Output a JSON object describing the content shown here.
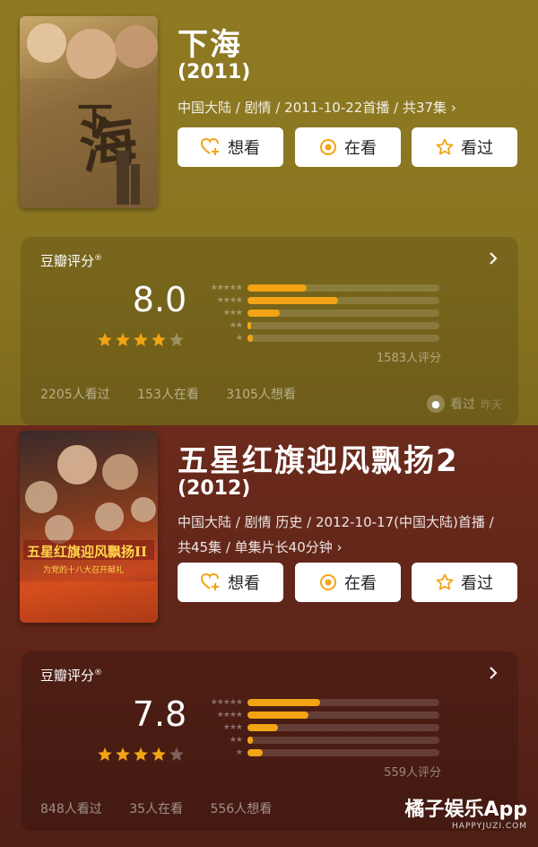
{
  "movies": [
    {
      "title": "下海",
      "year": "(2011)",
      "meta": "中国大陆 / 剧情 / 2011-10-22首播 / 共37集",
      "meta_more": "›",
      "buttons": [
        "想看",
        "在看",
        "看过"
      ],
      "rating": {
        "label": "豆瓣评分",
        "label_mark": "®",
        "score": "8.0",
        "stars_filled": 4,
        "distribution": [
          0.31,
          0.47,
          0.17,
          0.02,
          0.03
        ],
        "count": "1583人评分"
      },
      "watch": [
        "2205人看过",
        "153人在看",
        "3105人想看"
      ],
      "seen": {
        "label": "看过",
        "when": "昨天"
      }
    },
    {
      "title": "五星红旗迎风飘扬2",
      "year": "(2012)",
      "meta": "中国大陆 / 剧情 历史 / 2012-10-17(中国大陆)首播 / 共45集 / 单集片长40分钟",
      "meta_more": "›",
      "buttons": [
        "想看",
        "在看",
        "看过"
      ],
      "rating": {
        "label": "豆瓣评分",
        "label_mark": "®",
        "score": "7.8",
        "stars_filled": 4,
        "distribution": [
          0.38,
          0.32,
          0.16,
          0.03,
          0.08
        ],
        "count": "559人评分"
      },
      "watch": [
        "848人看过",
        "35人在看",
        "556人想看"
      ]
    }
  ],
  "watermark": {
    "main": "橘子娱乐App",
    "sub": "HAPPYJUZI.COM"
  },
  "colors": {
    "accent": "#f2a414",
    "star": "#f2a414"
  }
}
